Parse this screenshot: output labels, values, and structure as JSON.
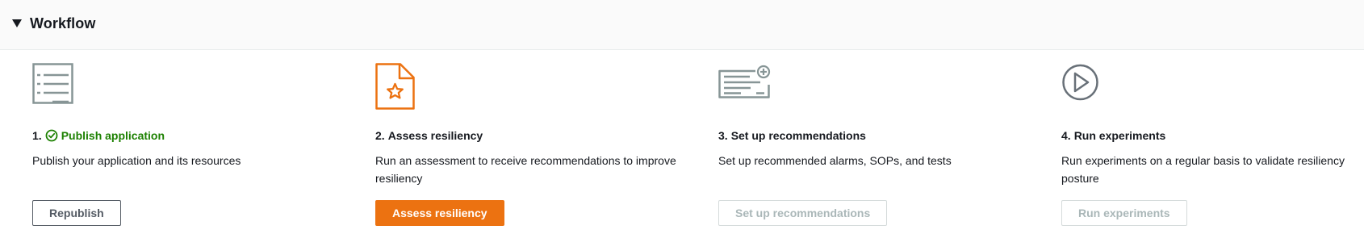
{
  "section": {
    "title": "Workflow",
    "caret_icon": "caret-down-icon"
  },
  "colors": {
    "success": "#1d8102",
    "primary": "#ec7211",
    "icon_gray": "#879596",
    "disabled_text": "#aab7b8"
  },
  "steps": [
    {
      "number": "1.",
      "title": "Publish application",
      "status": "complete",
      "status_icon": "check-circle-icon",
      "description": "Publish your application and its resources",
      "button": {
        "label": "Republish",
        "variant": "normal",
        "disabled": false
      },
      "icon": "list-document-icon"
    },
    {
      "number": "2.",
      "title": "Assess resiliency",
      "status": "current",
      "description": "Run an assessment to receive recommendations to improve resiliency",
      "button": {
        "label": "Assess resiliency",
        "variant": "primary",
        "disabled": false
      },
      "icon": "starred-document-icon"
    },
    {
      "number": "3.",
      "title": "Set up recommendations",
      "status": "pending",
      "description": "Set up recommended alarms, SOPs, and tests",
      "button": {
        "label": "Set up recommendations",
        "variant": "normal",
        "disabled": true
      },
      "icon": "add-recommendations-icon"
    },
    {
      "number": "4.",
      "title": "Run experiments",
      "status": "pending",
      "description": "Run experiments on a regular basis to validate resiliency posture",
      "button": {
        "label": "Run experiments",
        "variant": "normal",
        "disabled": true
      },
      "icon": "play-circle-icon"
    }
  ]
}
